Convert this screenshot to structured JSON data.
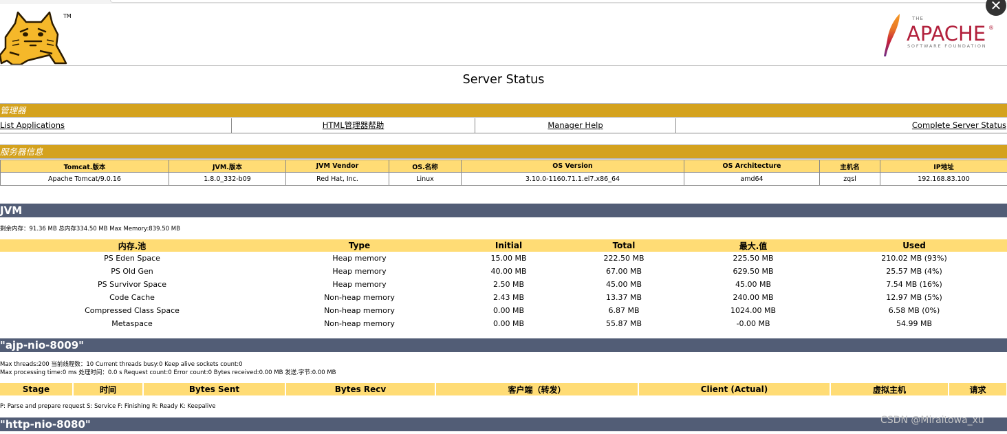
{
  "browser": {
    "close_label": "✕"
  },
  "logos": {
    "tomcat_tm": "TM",
    "apache_the": "THE",
    "apache_word": "APACHE",
    "apache_reg": "®",
    "apache_sub": "SOFTWARE FOUNDATION"
  },
  "page_title": "Server Status",
  "manager": {
    "title": "管理器",
    "links": [
      "List Applications",
      "HTML管理器帮助",
      "Manager Help",
      "Complete Server Status"
    ]
  },
  "server_info": {
    "title": "服务器信息",
    "headers": [
      "Tomcat.版本",
      "JVM.版本",
      "JVM Vendor",
      "OS.名称",
      "OS Version",
      "OS Architecture",
      "主机名",
      "IP地址"
    ],
    "values": [
      "Apache Tomcat/9.0.16",
      "1.8.0_332-b09",
      "Red Hat, Inc.",
      "Linux",
      "3.10.0-1160.71.1.el7.x86_64",
      "amd64",
      "zqsl",
      "192.168.83.100"
    ]
  },
  "jvm": {
    "title": "JVM",
    "memory_line": "剩余内存：91.36 MB 总内存334.50 MB Max Memory:839.50 MB",
    "headers": [
      "内存.池",
      "Type",
      "Initial",
      "Total",
      "最大.值",
      "Used"
    ],
    "rows": [
      [
        "PS Eden Space",
        "Heap memory",
        "15.00 MB",
        "222.50 MB",
        "225.50 MB",
        "210.02 MB (93%)"
      ],
      [
        "PS Old Gen",
        "Heap memory",
        "40.00 MB",
        "67.00 MB",
        "629.50 MB",
        "25.57 MB (4%)"
      ],
      [
        "PS Survivor Space",
        "Heap memory",
        "2.50 MB",
        "45.00 MB",
        "45.00 MB",
        "7.54 MB (16%)"
      ],
      [
        "Code Cache",
        "Non-heap memory",
        "2.43 MB",
        "13.37 MB",
        "240.00 MB",
        "12.97 MB (5%)"
      ],
      [
        "Compressed Class Space",
        "Non-heap memory",
        "0.00 MB",
        "6.87 MB",
        "1024.00 MB",
        "6.58 MB (0%)"
      ],
      [
        "Metaspace",
        "Non-heap memory",
        "0.00 MB",
        "55.87 MB",
        "-0.00 MB",
        "54.99 MB"
      ]
    ]
  },
  "ajp": {
    "title": "\"ajp-nio-8009\"",
    "line1": "Max threads:200 当前线程数：10 Current threads busy:0 Keep alive sockets count:0",
    "line2": "Max processing time:0 ms 处理时间：0.0 s Request count:0 Error count:0 Bytes received:0.00 MB 发送.字节:0.00 MB",
    "headers": [
      "Stage",
      "时间",
      "Bytes Sent",
      "Bytes Recv",
      "客户端（转发）",
      "Client (Actual)",
      "虚拟主机",
      "请求"
    ],
    "legend": "P: Parse and prepare request S: Service F: Finishing R: Ready K: Keepalive"
  },
  "http": {
    "title": "\"http-nio-8080\""
  },
  "watermark": "CSDN @Miraitowa_xu",
  "colors": {
    "gold": "#d4a21e",
    "header_yellow": "#ffdc75",
    "slate": "#525d76",
    "apache_red": "#b2203c"
  }
}
